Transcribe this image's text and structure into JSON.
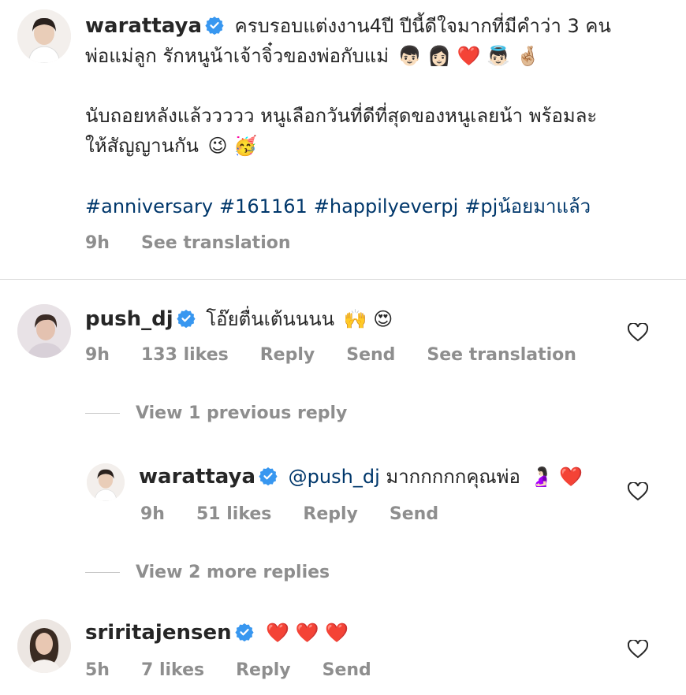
{
  "caption": {
    "username": "warattaya",
    "line1": "ครบรอบแต่งงาน4ปี ปีนี้ดีใจมากที่มีคำว่า 3 คน",
    "line2": "พ่อแม่ลูก รักหนูน้าเจ้าจิ๋วของพ่อกับแม่",
    "line2_emoji": "👦🏻 👩🏻 ❤️ 👼🏻 🤞🏼",
    "line3": "นับถอยหลังแล้ววววว หนูเลือกวันที่ดีที่สุดของหนูเลยน้า พร้อมละ",
    "line4": "ให้สัญญานกัน",
    "line4_emoji": "😉 🥳",
    "hashtags": [
      "#anniversary",
      "#161161",
      "#happilyeverpj",
      "#pjน้อยมาแล้ว"
    ],
    "time": "9h",
    "see_translation": "See translation"
  },
  "comments": [
    {
      "username": "push_dj",
      "text": "โอ๊ยตื่นเต้นนนน",
      "emoji": "🙌 😍",
      "time": "9h",
      "likes": "133 likes",
      "reply": "Reply",
      "send": "Send",
      "see_translation": "See translation",
      "view_previous": "View 1 previous reply",
      "reply_item": {
        "username": "warattaya",
        "mention": "@push_dj",
        "text": "มากกกกกคุณพ่อ",
        "emoji": "🤰🏻 ❤️",
        "time": "9h",
        "likes": "51 likes",
        "reply": "Reply",
        "send": "Send"
      },
      "view_more": "View 2 more replies"
    },
    {
      "username": "sriritajensen",
      "text": "",
      "emoji": "❤️ ❤️ ❤️",
      "time": "5h",
      "likes": "7 likes",
      "reply": "Reply",
      "send": "Send"
    }
  ],
  "colors": {
    "verified": "#3897f0",
    "hashtag": "#00376b",
    "meta": "#8e8e8e",
    "text": "#262626"
  },
  "icons": {
    "verified": "verified-badge-icon",
    "heart": "heart-outline-icon"
  }
}
